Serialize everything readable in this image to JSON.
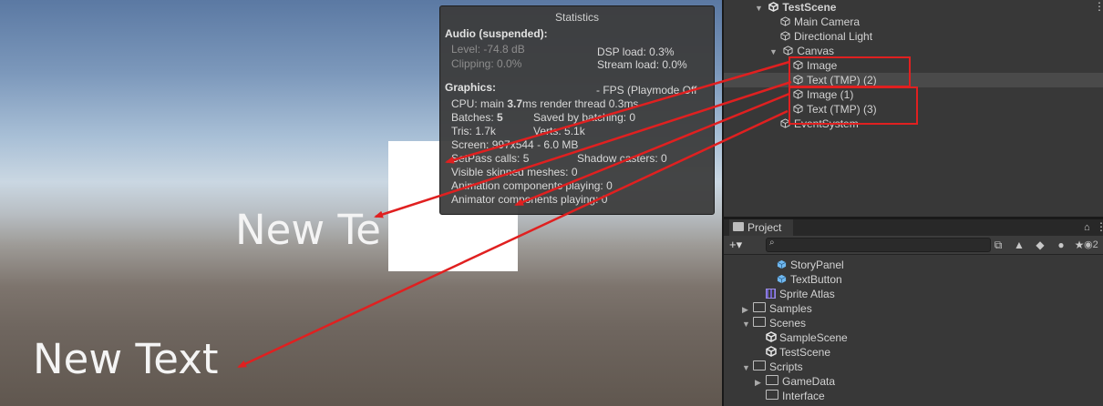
{
  "game_view": {
    "text_upper": "New Te",
    "text_lower": "New Text"
  },
  "statistics": {
    "title": "Statistics",
    "audio_heading": "Audio (suspended):",
    "level": "Level: -74.8 dB",
    "clipping": "Clipping: 0.0%",
    "dsp_load": "DSP load: 0.3%",
    "stream_load": "Stream load: 0.0%",
    "graphics_heading": "Graphics:",
    "fps": "- FPS (Playmode Off",
    "cpu_prefix": "CPU: main ",
    "cpu_main": "3.7",
    "cpu_suffix": "ms  render thread 0.3ms",
    "batches_label": "Batches: ",
    "batches_value": "5",
    "saved_batching": "Saved by batching: 0",
    "tris": "Tris: 1.7k",
    "verts": "Verts: 5.1k",
    "screen": "Screen: 997x544 - 6.0 MB",
    "setpass": "SetPass calls: 5",
    "shadow_casters": "Shadow casters: 0",
    "skinned_meshes": "Visible skinned meshes: 0",
    "animation_components": "Animation components playing: 0",
    "animator_components": "Animator components playing: 0"
  },
  "hierarchy": {
    "scene": "TestScene",
    "items": [
      "Main Camera",
      "Directional Light",
      "Canvas",
      "Image",
      "Text (TMP) (2)",
      "Image (1)",
      "Text (TMP) (3)",
      "EventSystem"
    ]
  },
  "project": {
    "tab": "Project",
    "add_button": "+▾",
    "hidden_count": "2",
    "items": [
      "StoryPanel",
      "TextButton",
      "Sprite Atlas",
      "Samples",
      "Scenes",
      "SampleScene",
      "TestScene",
      "Scripts",
      "GameData",
      "Interface"
    ]
  },
  "colors": {
    "annotation_red": "#e02020",
    "prefab_blue": "#6fb8f0",
    "selection": "#4a4a4a"
  }
}
